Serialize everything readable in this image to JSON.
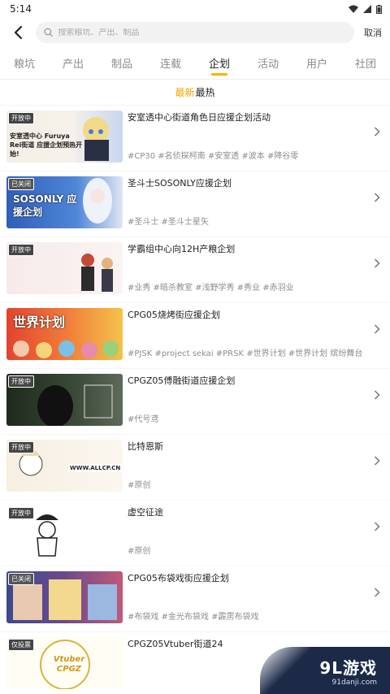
{
  "status": {
    "time": "5:14"
  },
  "search": {
    "placeholder": "搜索粮坑、产出、制品",
    "cancel_label": "取消"
  },
  "tabs": [
    {
      "label": "粮坑"
    },
    {
      "label": "产出"
    },
    {
      "label": "制品"
    },
    {
      "label": "连载"
    },
    {
      "label": "企划",
      "active": true
    },
    {
      "label": "活动"
    },
    {
      "label": "用户"
    },
    {
      "label": "社团"
    }
  ],
  "sort": {
    "latest": "最新",
    "hot": "最热"
  },
  "items": [
    {
      "badge": "开放中",
      "title": "安室透中心街道角色日应援企划活动",
      "tags": "#CP30 #名侦探柯南 #安室透 #波本 #降谷零",
      "thumb_text": "安室透中心 Furuya Rei街道 应援企划预热开始!",
      "thumb_color": "#f3efe6"
    },
    {
      "badge": "已关闭",
      "title": "圣斗士SOSONLY应援企划",
      "tags": "#圣斗士 #圣斗士星矢",
      "thumb_text": "SOSONLY 应援企划",
      "thumb_color": "#3a6fc8"
    },
    {
      "badge": "开放中",
      "title": "学霸组中心向12H产粮企划",
      "tags": "#业秀 #暗杀教室 #浅野学秀 #秀业 #赤羽业",
      "thumb_text": "",
      "thumb_color": "#f7eaea"
    },
    {
      "badge": "",
      "title": "CPG05烧烤街应援企划",
      "tags": "#PJSK #project sekai #PRSK #世界计划 #世界计划 缤纷舞台",
      "thumb_text": "世界计划",
      "thumb_color": "#e2442e"
    },
    {
      "badge": "开放中",
      "title": "CPGZ05傅融街道应援企划",
      "tags": "#代号鸢",
      "thumb_text": "",
      "thumb_color": "#2f3a2c"
    },
    {
      "badge": "开放中",
      "title": "比特恩斯",
      "tags": "#原创",
      "thumb_text": "WWW.ALLCP.CN",
      "thumb_color": "#f6efe2"
    },
    {
      "badge": "开放中",
      "title": "虚空征途",
      "tags": "#原创",
      "thumb_text": "",
      "thumb_color": "#ffffff"
    },
    {
      "badge": "已关闭",
      "title": "CPG05布袋戏街应援企划",
      "tags": "#布袋戏 #金光布袋戏 #霹雳布袋戏",
      "thumb_text": "",
      "thumb_color": "#4a3e6e"
    },
    {
      "badge": "仅投票",
      "title": "CPGZ05Vtuber街道24",
      "tags": "",
      "thumb_text": "Vtuber CPGZ",
      "thumb_color": "#fffdf4"
    }
  ],
  "watermark": {
    "main": "9L游戏",
    "sub": "91danji.com"
  },
  "colors": {
    "accent": "#f5b400",
    "sort_active": "#f0a500"
  }
}
